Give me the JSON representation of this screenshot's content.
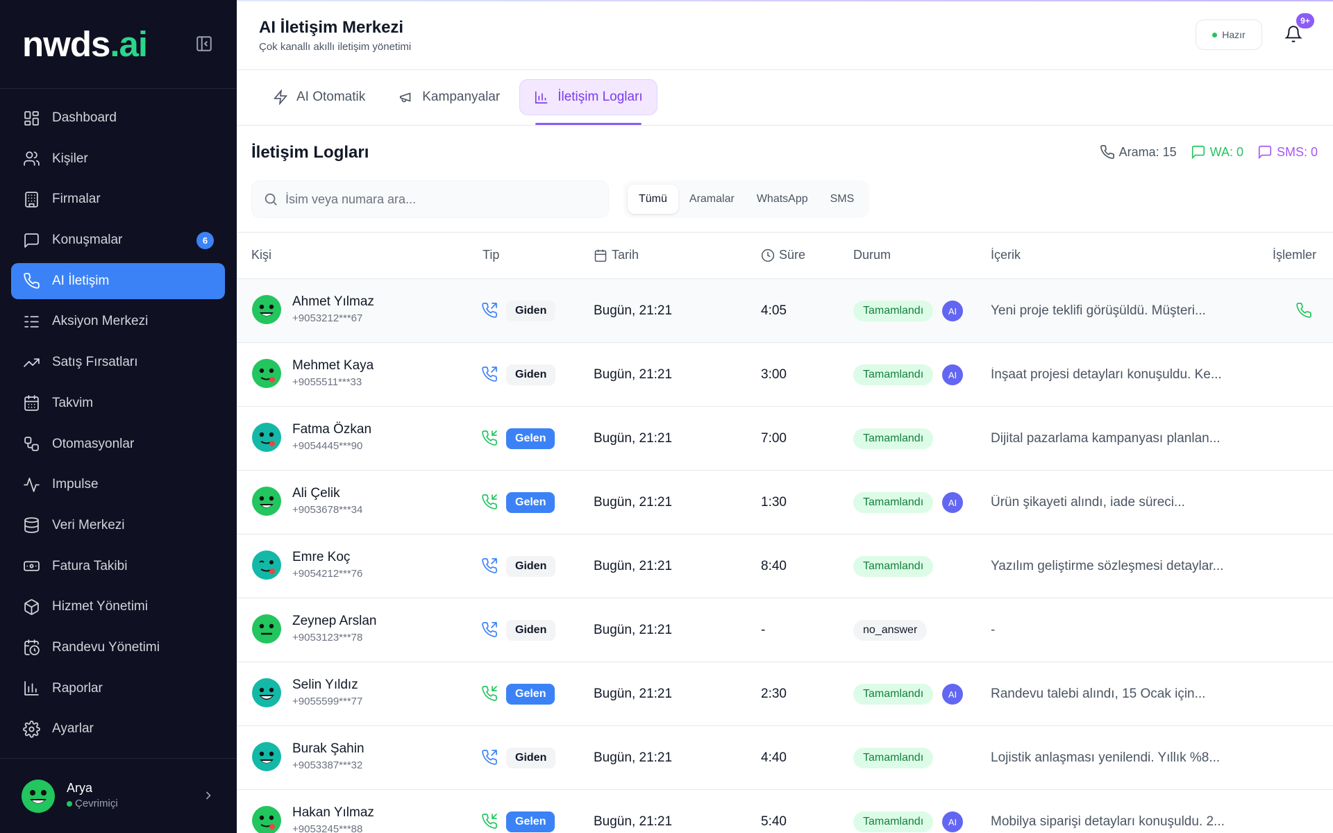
{
  "brand": {
    "name": "nwds",
    "suffix": ".ai"
  },
  "sidebar": {
    "items": [
      {
        "label": "Dashboard",
        "icon": "dashboard-icon"
      },
      {
        "label": "Kişiler",
        "icon": "users-icon"
      },
      {
        "label": "Firmalar",
        "icon": "building-icon"
      },
      {
        "label": "Konuşmalar",
        "icon": "chat-icon",
        "badge": "6"
      },
      {
        "label": "AI İletişim",
        "icon": "phone-icon",
        "active": true
      },
      {
        "label": "Aksiyon Merkezi",
        "icon": "list-check-icon"
      },
      {
        "label": "Satış Fırsatları",
        "icon": "trending-up-icon"
      },
      {
        "label": "Takvim",
        "icon": "calendar-icon"
      },
      {
        "label": "Otomasyonlar",
        "icon": "workflow-icon"
      },
      {
        "label": "Impulse",
        "icon": "activity-icon"
      },
      {
        "label": "Veri Merkezi",
        "icon": "database-icon"
      },
      {
        "label": "Fatura Takibi",
        "icon": "invoice-icon"
      },
      {
        "label": "Hizmet Yönetimi",
        "icon": "package-icon"
      },
      {
        "label": "Randevu Yönetimi",
        "icon": "calendar-clock-icon"
      },
      {
        "label": "Raporlar",
        "icon": "bar-chart-icon"
      },
      {
        "label": "Ayarlar",
        "icon": "gear-icon"
      }
    ],
    "user": {
      "name": "Arya",
      "status": "Çevrimiçi"
    }
  },
  "header": {
    "title": "AI İletişim Merkezi",
    "subtitle": "Çok kanallı akıllı iletişim yönetimi",
    "status": "Hazır",
    "notification_badge": "9+"
  },
  "tabs": [
    {
      "label": "AI Otomatik",
      "icon": "zap-icon"
    },
    {
      "label": "Kampanyalar",
      "icon": "megaphone-icon"
    },
    {
      "label": "İletişim Logları",
      "icon": "bar-chart-icon",
      "active": true
    }
  ],
  "logs": {
    "title": "İletişim Logları",
    "stats": {
      "call": "Arama: 15",
      "wa": "WA: 0",
      "sms": "SMS: 0"
    },
    "search_placeholder": "İsim veya numara ara...",
    "filters": [
      "Tümü",
      "Aramalar",
      "WhatsApp",
      "SMS"
    ],
    "columns": {
      "person": "Kişi",
      "type": "Tip",
      "date": "Tarih",
      "duration": "Süre",
      "status": "Durum",
      "content": "İçerik",
      "actions": "İşlemler"
    },
    "rows": [
      {
        "name": "Ahmet Yılmaz",
        "phone": "+9053212***67",
        "dir": "out",
        "type": "Giden",
        "date": "Bugün, 21:21",
        "duration": "4:05",
        "status": "Tamamlandı",
        "ai": "AI",
        "content": "Yeni proje teklifi görüşüldü. Müşteri...",
        "highlight": true,
        "action": true
      },
      {
        "name": "Mehmet Kaya",
        "phone": "+9055511***33",
        "dir": "out",
        "type": "Giden",
        "date": "Bugün, 21:21",
        "duration": "3:00",
        "status": "Tamamlandı",
        "ai": "AI",
        "content": "İnşaat projesi detayları konuşuldu. Ke..."
      },
      {
        "name": "Fatma Özkan",
        "phone": "+9054445***90",
        "dir": "in",
        "type": "Gelen",
        "date": "Bugün, 21:21",
        "duration": "7:00",
        "status": "Tamamlandı",
        "ai": "",
        "content": "Dijital pazarlama kampanyası planlan..."
      },
      {
        "name": "Ali Çelik",
        "phone": "+9053678***34",
        "dir": "in",
        "type": "Gelen",
        "date": "Bugün, 21:21",
        "duration": "1:30",
        "status": "Tamamlandı",
        "ai": "AI",
        "content": "Ürün şikayeti alındı, iade süreci..."
      },
      {
        "name": "Emre Koç",
        "phone": "+9054212***76",
        "dir": "out",
        "type": "Giden",
        "date": "Bugün, 21:21",
        "duration": "8:40",
        "status": "Tamamlandı",
        "ai": "",
        "content": "Yazılım geliştirme sözleşmesi detaylar..."
      },
      {
        "name": "Zeynep Arslan",
        "phone": "+9053123***78",
        "dir": "out",
        "type": "Giden",
        "date": "Bugün, 21:21",
        "duration": "-",
        "status": "no_answer",
        "ai": "",
        "content": "-"
      },
      {
        "name": "Selin Yıldız",
        "phone": "+9055599***77",
        "dir": "in",
        "type": "Gelen",
        "date": "Bugün, 21:21",
        "duration": "2:30",
        "status": "Tamamlandı",
        "ai": "AI",
        "content": "Randevu talebi alındı, 15 Ocak için..."
      },
      {
        "name": "Burak Şahin",
        "phone": "+9053387***32",
        "dir": "out",
        "type": "Giden",
        "date": "Bugün, 21:21",
        "duration": "4:40",
        "status": "Tamamlandı",
        "ai": "",
        "content": "Lojistik anlaşması yenilendi. Yıllık %8..."
      },
      {
        "name": "Hakan Yılmaz",
        "phone": "+9053245***88",
        "dir": "in",
        "type": "Gelen",
        "date": "Bugün, 21:21",
        "duration": "5:40",
        "status": "Tamamlandı",
        "ai": "AI",
        "content": "Mobilya siparişi detayları konuşuldu. 2..."
      }
    ]
  },
  "colors": {
    "accent": "#3b82f6",
    "sidebar_bg": "#0f1021",
    "purple": "#8b5cf6",
    "success": "#22c55e"
  }
}
